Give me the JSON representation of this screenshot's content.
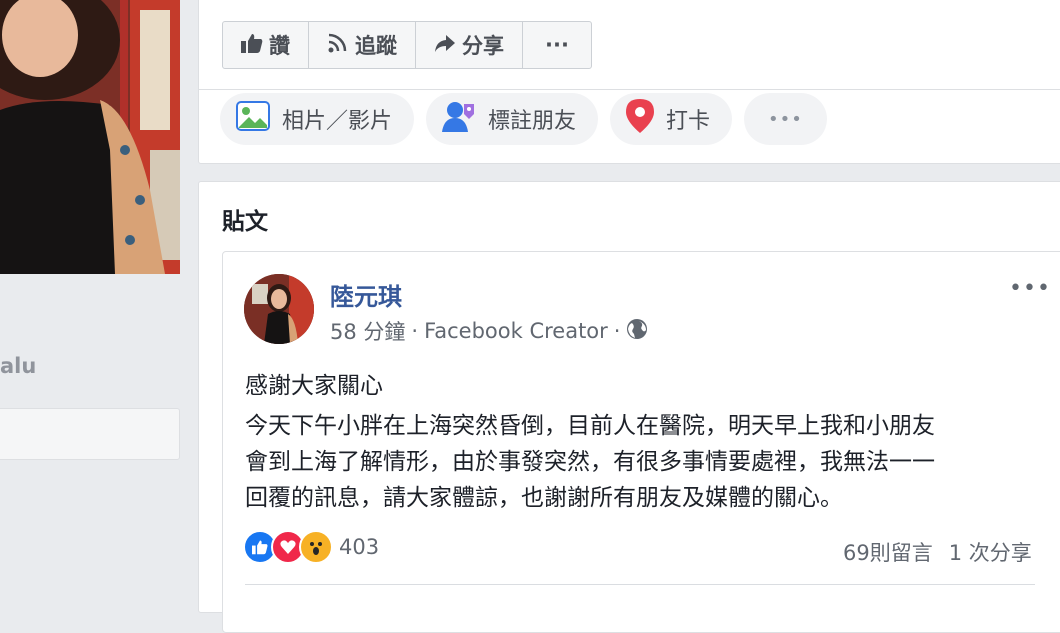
{
  "left_panel": {
    "name_partial": "alu"
  },
  "page_actions": [
    {
      "label": "讚",
      "icon": "thumbs-up-icon"
    },
    {
      "label": "追蹤",
      "icon": "rss-icon"
    },
    {
      "label": "分享",
      "icon": "share-arrow-icon"
    },
    {
      "label": "···",
      "icon": "more-icon"
    }
  ],
  "composer": {
    "photo_label": "相片／影片",
    "tag_label": "標註朋友",
    "checkin_label": "打卡",
    "more_label": "•••"
  },
  "posts_section": {
    "title": "貼文"
  },
  "post": {
    "author": "陸元琪",
    "time": "58 分鐘",
    "separator": "·",
    "app": "Facebook Creator",
    "privacy_icon": "globe-icon",
    "more": "•••",
    "first_line": "感謝大家關心",
    "body_lines": [
      "今天下午小胖在上海突然昏倒，目前人在醫院，明天早上我和小朋友",
      "會到上海了解情形，由於事發突然，有很多事情要處裡，我無法一一",
      "回覆的訊息，請大家體諒，也謝謝所有朋友及媒體的關心。"
    ],
    "reaction_count": "403",
    "comments": "69則留言",
    "shares": "1 次分享"
  },
  "colors": {
    "link": "#365899",
    "like_blue": "#1877f2",
    "love_red": "#f0284a",
    "wow_yellow": "#f7b125",
    "checkin_red": "#e9414f",
    "photo_green": "#5bb559"
  }
}
